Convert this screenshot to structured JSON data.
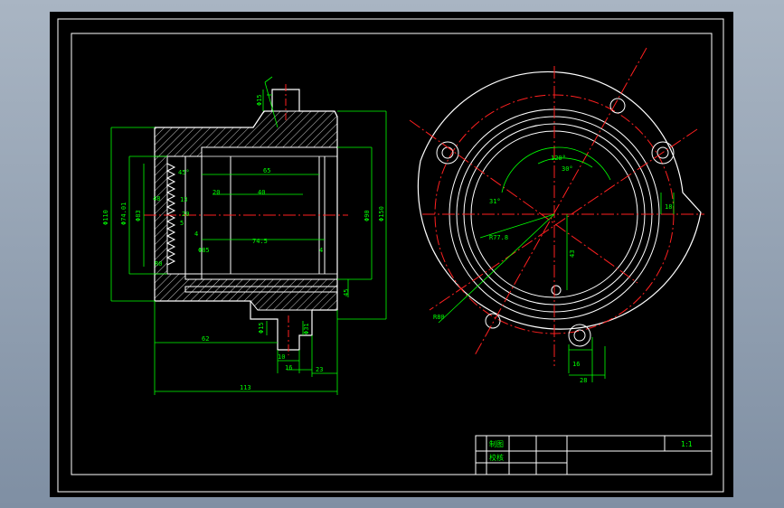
{
  "colors": {
    "background": "#000000",
    "outline": "#ffffff",
    "hatch": "#ffffff",
    "dimension": "#00ff00",
    "centerline": "#ff2020",
    "frame": "#ffffff"
  },
  "section_view": {
    "dims_vertical_left": [
      "Φ110",
      "Φ74.01",
      "Φ83"
    ],
    "dims_vertical_right": [
      "Φ90",
      "Φ150"
    ],
    "small_dims": [
      "48",
      "20",
      "13",
      "4",
      "5",
      "Φ85",
      "R0"
    ],
    "internal_dims": [
      "65",
      "40",
      "20",
      "74.5"
    ],
    "angle": "45°",
    "tolerance_right": "45",
    "bottom_dims": [
      "62",
      "10",
      "16",
      "23",
      "113"
    ],
    "boss_dims": [
      "Φ15",
      "Φ31"
    ]
  },
  "flange_view": {
    "angles": [
      "120°",
      "30°",
      "31°"
    ],
    "radius": "R77.8",
    "dims": [
      "43",
      "18",
      "16",
      "28",
      "R80"
    ]
  },
  "title_block": {
    "row1_label": "制图",
    "row2_label": "校核",
    "scale": "1:1"
  }
}
